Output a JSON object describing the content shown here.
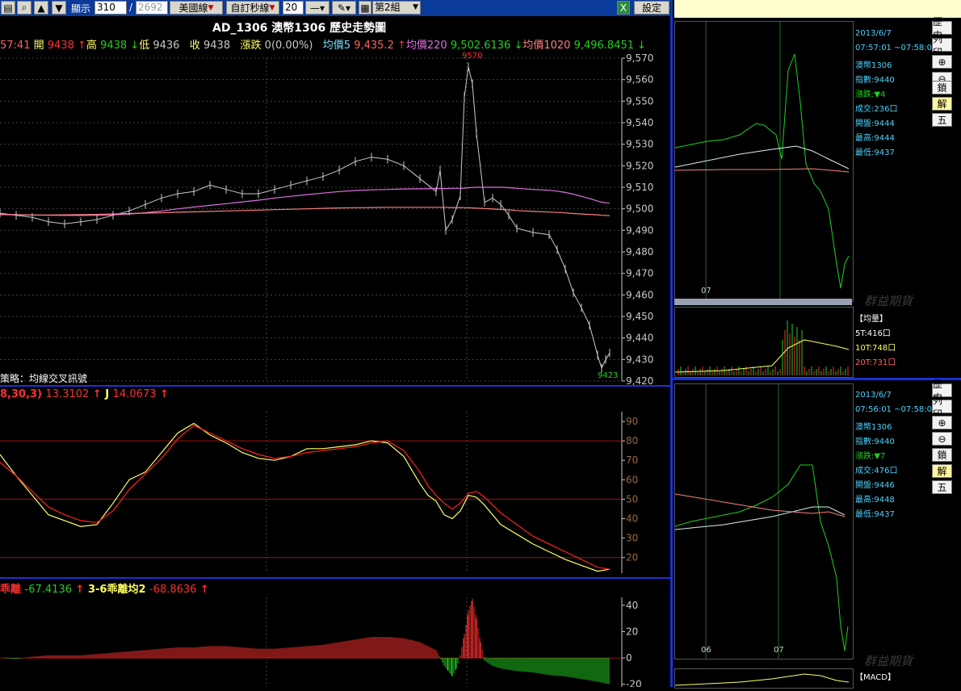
{
  "toolbar": {
    "display_label": "顯示",
    "display_value": "310",
    "slash": "/",
    "display_total": "2692",
    "style_select": "美國線",
    "interval_select": "自訂秒線",
    "interval_value": "20",
    "group_select": "第2組",
    "settings_label": "設定"
  },
  "title": "AD_1306 澳幣1306  歷史走勢圖",
  "legend": {
    "time": "57:41",
    "open_label": "開",
    "open": "9438",
    "high_label": "高",
    "high": "9438",
    "low_label": "低",
    "low": "9436",
    "close_label": "收",
    "close": "9438",
    "change_label": "漲跌",
    "change": "0(0.00%)",
    "ma5_label": "均價5",
    "ma5": "9,435.2",
    "ma220_label": "均價220",
    "ma220": "9,502.6136",
    "ma1020_label": "均價1020",
    "ma1020": "9,496.8451"
  },
  "strategy_text": "策略：均線交叉訊號",
  "kd_legend": {
    "params": "8,30,3)",
    "k": "13.3102",
    "j_label": "J",
    "j": "14.0673"
  },
  "bias_legend": {
    "name": "乖離",
    "value": "-67.4136",
    "avg_label": "3-6乖離均2",
    "avg_value": "-68.8636"
  },
  "colors": {
    "price": "#c9c9c9",
    "ma220": "#e070e0",
    "ma1020": "#ff8080",
    "k": "#ffff66",
    "d": "#ff2020",
    "grid": "#444444",
    "axis": "#c9c9c9",
    "bar_up": "#ff3030",
    "bar_down": "#20d020",
    "separator": "#1b2fd8"
  },
  "chart_data": [
    {
      "type": "line",
      "name": "price-chart",
      "title": "AD_1306 澳幣1306  歷史走勢圖",
      "ylim": [
        9420,
        9570
      ],
      "yticks": [
        "9,420",
        "9,430",
        "9,440",
        "9,450",
        "9,460",
        "9,470",
        "9,480",
        "9,490",
        "9,500",
        "9,510",
        "9,520",
        "9,530",
        "9,540",
        "9,550",
        "9,560",
        "9,570"
      ],
      "x": [
        0,
        20,
        40,
        60,
        80,
        100,
        120,
        140,
        160,
        180,
        200,
        220,
        240,
        260,
        280,
        300,
        320,
        340,
        360,
        380,
        400,
        420,
        440,
        460,
        480,
        500,
        520,
        540,
        545,
        552,
        560,
        570,
        575,
        580,
        585,
        590,
        600,
        610,
        620,
        630,
        640,
        660,
        680,
        690,
        700,
        710,
        720,
        730,
        740,
        745,
        750,
        755
      ],
      "series": [
        {
          "name": "close",
          "values": [
            9498,
            9497,
            9496,
            9494,
            9493,
            9494,
            9495,
            9497,
            9499,
            9502,
            9505,
            9507,
            9508,
            9511,
            9509,
            9507,
            9507,
            9509,
            9511,
            9513,
            9515,
            9518,
            9522,
            9524,
            9523,
            9520,
            9514,
            9508,
            9518,
            9490,
            9495,
            9506,
            9552,
            9566,
            9558,
            9535,
            9503,
            9505,
            9502,
            9497,
            9491,
            9489,
            9488,
            9481,
            9472,
            9461,
            9454,
            9446,
            9432,
            9426,
            9430,
            9433
          ]
        },
        {
          "name": "均價220",
          "values": [
            9497.5,
            9497.3,
            9497.1,
            9497,
            9496.9,
            9496.9,
            9497,
            9497.2,
            9497.6,
            9498.2,
            9499,
            9500,
            9500.8,
            9501.6,
            9502.4,
            9503.2,
            9504,
            9505,
            9505.8,
            9506.6,
            9507.3,
            9508,
            9508.5,
            9508.8,
            9509,
            9509.2,
            9509.3,
            9509.4,
            9509.4,
            9509.4,
            9509.5,
            9509.5,
            9509.6,
            9509.8,
            9509.9,
            9510,
            9510,
            9510,
            9510,
            9509.8,
            9509.5,
            9509,
            9508.6,
            9508.2,
            9507.6,
            9506.8,
            9505.8,
            9504.8,
            9503.6,
            9503.1,
            9502.8,
            9502.6
          ]
        },
        {
          "name": "均價1020",
          "values": [
            9497.3,
            9497.2,
            9497.1,
            9497.1,
            9497.2,
            9497.3,
            9497.4,
            9497.6,
            9497.8,
            9498,
            9498.2,
            9498.4,
            9498.6,
            9498.8,
            9499,
            9499.2,
            9499.4,
            9499.6,
            9499.8,
            9500,
            9500.2,
            9500.4,
            9500.5,
            9500.6,
            9500.7,
            9500.7,
            9500.7,
            9500.7,
            9500.7,
            9500.7,
            9500.6,
            9500.6,
            9500.5,
            9500.5,
            9500.4,
            9500.3,
            9500.1,
            9499.9,
            9499.7,
            9499.5,
            9499.2,
            9498.8,
            9498.5,
            9498.3,
            9498.1,
            9497.8,
            9497.6,
            9497.4,
            9497.2,
            9497.0,
            9496.9,
            9496.8
          ]
        }
      ],
      "annotations": [
        {
          "text": "9570",
          "x": 582,
          "y": 9570
        },
        {
          "text": "9423",
          "x": 750,
          "y": 9423
        }
      ]
    },
    {
      "type": "line",
      "name": "kd-chart",
      "ylim": [
        12,
        95
      ],
      "yticks": [
        "20",
        "30",
        "40",
        "50",
        "60",
        "70",
        "80",
        "90"
      ],
      "gridlines": [
        20,
        50,
        80
      ],
      "x": [
        0,
        20,
        40,
        60,
        80,
        100,
        120,
        140,
        160,
        180,
        200,
        220,
        240,
        260,
        280,
        300,
        320,
        340,
        360,
        380,
        400,
        420,
        440,
        460,
        480,
        500,
        520,
        530,
        540,
        550,
        560,
        570,
        580,
        590,
        600,
        620,
        640,
        660,
        680,
        700,
        720,
        740,
        755
      ],
      "series": [
        {
          "name": "K",
          "values": [
            73,
            62,
            52,
            42,
            39,
            36,
            37,
            48,
            60,
            64,
            74,
            84,
            89,
            83,
            79,
            74,
            71,
            70,
            72,
            76,
            76,
            77,
            78,
            80,
            79,
            72,
            58,
            52,
            49,
            42,
            40,
            44,
            52,
            51,
            47,
            37,
            32,
            27,
            23,
            19,
            16,
            13,
            14
          ]
        },
        {
          "name": "D",
          "values": [
            69,
            62,
            54,
            46,
            42,
            39,
            38,
            44,
            55,
            63,
            71,
            81,
            88,
            84,
            80,
            76,
            73,
            71,
            72,
            74,
            75,
            76,
            77,
            79,
            80,
            75,
            64,
            57,
            52,
            48,
            45,
            48,
            53,
            54,
            51,
            43,
            37,
            31,
            27,
            23,
            19,
            15,
            14
          ]
        }
      ]
    },
    {
      "type": "bar",
      "name": "bias-chart",
      "ylim": [
        -22,
        46
      ],
      "yticks": [
        "-20",
        "0",
        "20",
        "40"
      ],
      "x": [
        0,
        20,
        40,
        60,
        80,
        100,
        120,
        140,
        160,
        180,
        200,
        220,
        240,
        260,
        280,
        300,
        320,
        340,
        360,
        380,
        400,
        420,
        440,
        460,
        480,
        500,
        520,
        540,
        550,
        555,
        560,
        565,
        570,
        575,
        580,
        585,
        590,
        595,
        600,
        610,
        620,
        640,
        660,
        680,
        700,
        720,
        740,
        755
      ],
      "values": [
        0,
        -1,
        1,
        2,
        2,
        2,
        3,
        4,
        5,
        6,
        7,
        8,
        8,
        9,
        9,
        8,
        7,
        7,
        8,
        9,
        10,
        12,
        14,
        16,
        16,
        15,
        12,
        6,
        -6,
        -10,
        -14,
        -8,
        2,
        18,
        36,
        45,
        30,
        12,
        -2,
        -6,
        -8,
        -10,
        -11,
        -13,
        -14,
        -16,
        -18,
        -20
      ]
    }
  ],
  "right_panels": [
    {
      "date": "2013/6/7",
      "time": "07:57:01  ~07:58:00",
      "symbol": "澳幣1306",
      "index": "指數:9440",
      "change": "漲跌:▼4",
      "volume": "成交:236口",
      "open": "開盤:9444",
      "high": "最高:9444",
      "low": "最低:9437",
      "axis_label": "07",
      "sub_title": "【均量】",
      "sub_lines": [
        "5T:416口",
        "10T:748口",
        "20T:731口"
      ],
      "watermark": "群益期貨"
    },
    {
      "date": "2013/6/7",
      "time": "07:56:01  ~07:58:00",
      "symbol": "澳幣1306",
      "index": "指數:9440",
      "change": "漲跌:▼7",
      "volume": "成交:476口",
      "open": "開盤:9446",
      "high": "最高:9448",
      "low": "最低:9437",
      "axis_label": "06",
      "axis_label2": "07",
      "sub_title": "【MACD】",
      "watermark": "群益期貨"
    }
  ],
  "right_buttons": {
    "history": "歷史",
    "print": "列印",
    "lock": "鎖",
    "unlock": "解",
    "five": "五"
  }
}
